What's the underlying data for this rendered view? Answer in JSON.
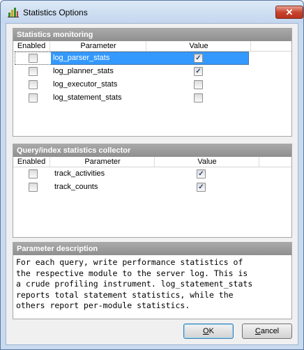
{
  "window": {
    "title": "Statistics Options",
    "close_glyph": "✕"
  },
  "monitoring": {
    "header": "Statistics monitoring",
    "columns": {
      "enabled": "Enabled",
      "parameter": "Parameter",
      "value": "Value"
    },
    "rows": [
      {
        "name": "log_parser_stats",
        "enabled": false,
        "value": true,
        "selected": true
      },
      {
        "name": "log_planner_stats",
        "enabled": false,
        "value": true,
        "selected": false
      },
      {
        "name": "log_executor_stats",
        "enabled": false,
        "value": false,
        "selected": false
      },
      {
        "name": "log_statement_stats",
        "enabled": false,
        "value": false,
        "selected": false
      }
    ]
  },
  "collector": {
    "header": "Query/index statistics collector",
    "columns": {
      "enabled": "Enabled",
      "parameter": "Parameter",
      "value": "Value"
    },
    "rows": [
      {
        "name": "track_activities",
        "enabled": false,
        "value": true
      },
      {
        "name": "track_counts",
        "enabled": false,
        "value": true
      }
    ]
  },
  "description": {
    "header": "Parameter description",
    "text": "For each query, write performance statistics of\nthe respective module to the server log. This is\na crude profiling instrument. log_statement_stats\nreports total statement statistics, while the\nothers report per-module statistics."
  },
  "buttons": {
    "ok_accel": "O",
    "ok_rest": "K",
    "cancel_accel": "C",
    "cancel_rest": "ancel"
  },
  "check_glyph": "✓"
}
